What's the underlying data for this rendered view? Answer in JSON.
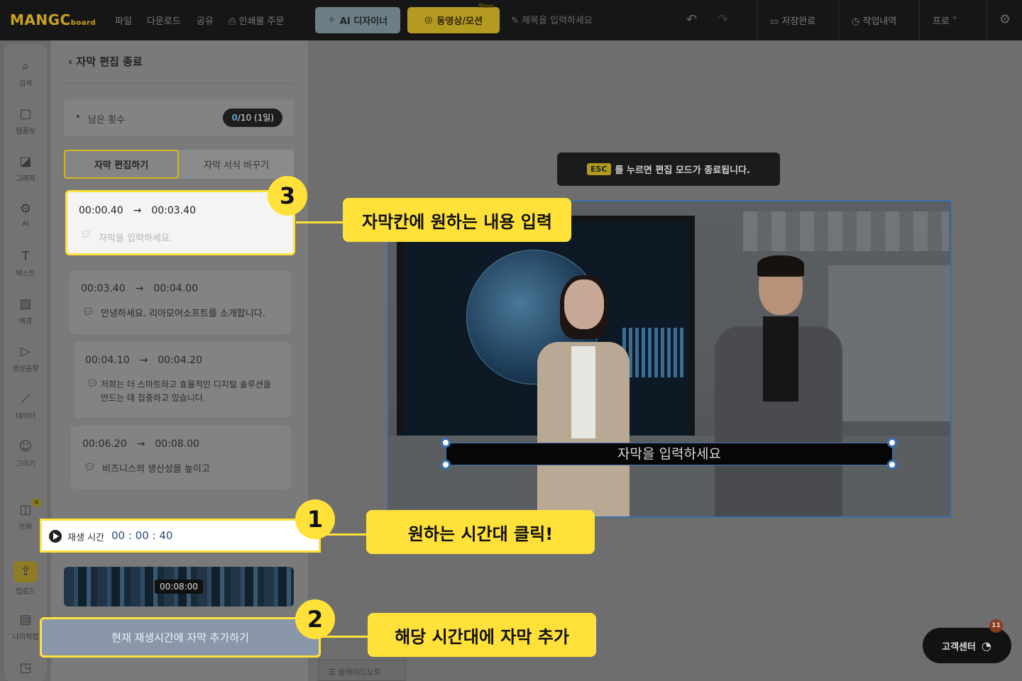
{
  "topbar": {
    "logo_main": "MANGC",
    "logo_sub": "board",
    "menu": [
      "파일",
      "다운로드",
      "공유",
      "인쇄물 주문"
    ],
    "ai_designer": "AI 디자이너",
    "video_motion": "동영상/모션",
    "new_badge": "New",
    "title_placeholder": "제목을 입력하세요",
    "save_status": "저장완료",
    "history": "작업내역",
    "profile": "프로"
  },
  "iconbar": {
    "items": [
      "검색",
      "템플릿",
      "그래픽",
      "AI",
      "텍스트",
      "배경",
      "영상음향",
      "데이터",
      "그리기",
      "만화",
      "업로드",
      "나의작업"
    ],
    "manhwa_badge": "N"
  },
  "panel": {
    "header": "자막 편집 종료",
    "remain_label": "남은 횟수",
    "remain_used": "0",
    "remain_total": "/10 (1일)",
    "tab_edit": "자막 편집하기",
    "tab_style": "자막 서식 바꾸기",
    "subtitles": [
      {
        "start": "00:00.40",
        "end": "00:03.40",
        "text": "자막을 입력하세요."
      },
      {
        "start": "00:03.40",
        "end": "00:04.00",
        "text": "안녕하세요. 리아모어소프트를 소개합니다."
      },
      {
        "start": "00:04.10",
        "end": "00:04.20",
        "text": "저희는 더 스마트하고 효율적인 디지털 솔루션을 만드는 데 집중하고 있습니다."
      },
      {
        "start": "00:06.20",
        "end": "00:08.00",
        "text": "비즈니스의 생산성을 높이고"
      }
    ],
    "playtime_label": "재생 시간",
    "playtime_value": "00 : 00 : 40",
    "film_time": "00:08:00",
    "add_button": "현재 재생시간에 자막 추가하기",
    "slide_note": "슬라이드노트"
  },
  "canvas": {
    "esc_key": "ESC",
    "esc_text": "를 누르면 편집 모드가 종료됩니다.",
    "subtitle_placeholder": "자막을 입력하세요"
  },
  "callouts": {
    "step1_num": "1",
    "step1_text": "원하는 시간대 클릭!",
    "step2_num": "2",
    "step2_text": "해당 시간대에 자막 추가",
    "step3_num": "3",
    "step3_text": "자막칸에 원하는 내용 입력"
  },
  "support": {
    "label": "고객센터",
    "badge": "11"
  },
  "colors": {
    "highlight": "#ffe13a",
    "selection": "#3a6fb0",
    "topbar": "#161616"
  }
}
